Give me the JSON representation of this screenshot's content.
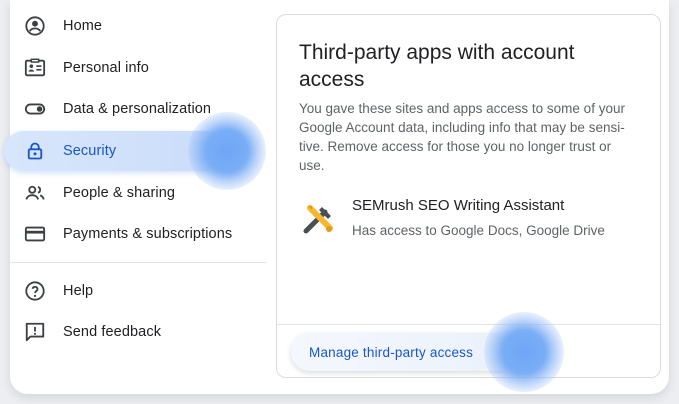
{
  "sidebar": {
    "items": [
      {
        "label": "Home",
        "icon": "account-circle-icon"
      },
      {
        "label": "Personal info",
        "icon": "id-card-icon"
      },
      {
        "label": "Data & personalization",
        "icon": "toggle-icon"
      },
      {
        "label": "Security",
        "icon": "lock-icon",
        "active": true
      },
      {
        "label": "People & sharing",
        "icon": "people-icon"
      },
      {
        "label": "Payments & subscriptions",
        "icon": "credit-card-icon"
      },
      {
        "label": "Help",
        "icon": "help-circle-icon"
      },
      {
        "label": "Send feedback",
        "icon": "feedback-icon"
      }
    ]
  },
  "card": {
    "title": "Third-party apps with account access",
    "description": "You gave these sites and apps access to some of your Google Account data, including info that may be sensi-tive. Remove access for those you no longer trust or use.",
    "app": {
      "name": "SEMrush SEO Writing Assistant",
      "access": "Has access to Google Docs, Google Drive",
      "icon": "semrush-tools-icon"
    },
    "manage_label": "Manage third-party access"
  },
  "colors": {
    "accent": "#1a56c8",
    "active_bg": "#d7e6fb",
    "halo": "#6ea5f6",
    "icon_gray": "#5f6368"
  }
}
